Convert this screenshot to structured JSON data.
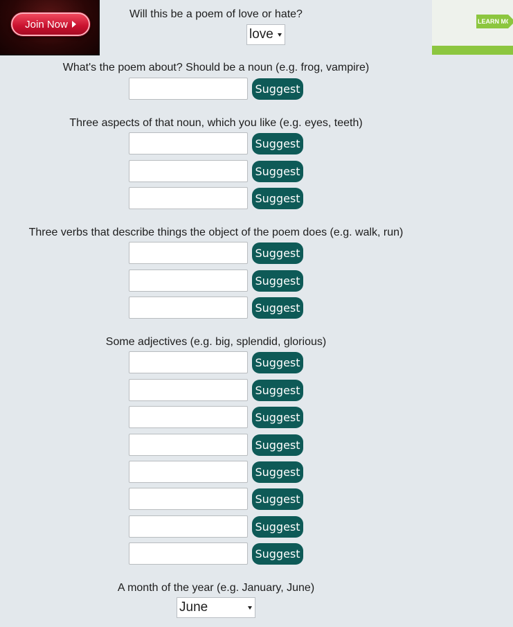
{
  "ads": {
    "left": {
      "button_label": "Join Now"
    },
    "right": {
      "button_label": "LEARN MORE"
    }
  },
  "love_or_hate": {
    "question": "Will this be a poem of love or hate?",
    "selected": "love"
  },
  "noun": {
    "question": "What's the poem about? Should be a noun (e.g. frog, vampire)",
    "fields": [
      {
        "value": "",
        "button": "Suggest"
      }
    ]
  },
  "aspects": {
    "question": "Three aspects of that noun, which you like (e.g. eyes, teeth)",
    "fields": [
      {
        "value": "",
        "button": "Suggest"
      },
      {
        "value": "",
        "button": "Suggest"
      },
      {
        "value": "",
        "button": "Suggest"
      }
    ]
  },
  "verbs": {
    "question": "Three verbs that describe things the object of the poem does (e.g. walk, run)",
    "fields": [
      {
        "value": "",
        "button": "Suggest"
      },
      {
        "value": "",
        "button": "Suggest"
      },
      {
        "value": "",
        "button": "Suggest"
      }
    ]
  },
  "adjectives": {
    "question": "Some adjectives (e.g. big, splendid, glorious)",
    "fields": [
      {
        "value": "",
        "button": "Suggest"
      },
      {
        "value": "",
        "button": "Suggest"
      },
      {
        "value": "",
        "button": "Suggest"
      },
      {
        "value": "",
        "button": "Suggest"
      },
      {
        "value": "",
        "button": "Suggest"
      },
      {
        "value": "",
        "button": "Suggest"
      },
      {
        "value": "",
        "button": "Suggest"
      },
      {
        "value": "",
        "button": "Suggest"
      }
    ]
  },
  "month": {
    "question": "A month of the year (e.g. January, June)",
    "selected": "June"
  }
}
